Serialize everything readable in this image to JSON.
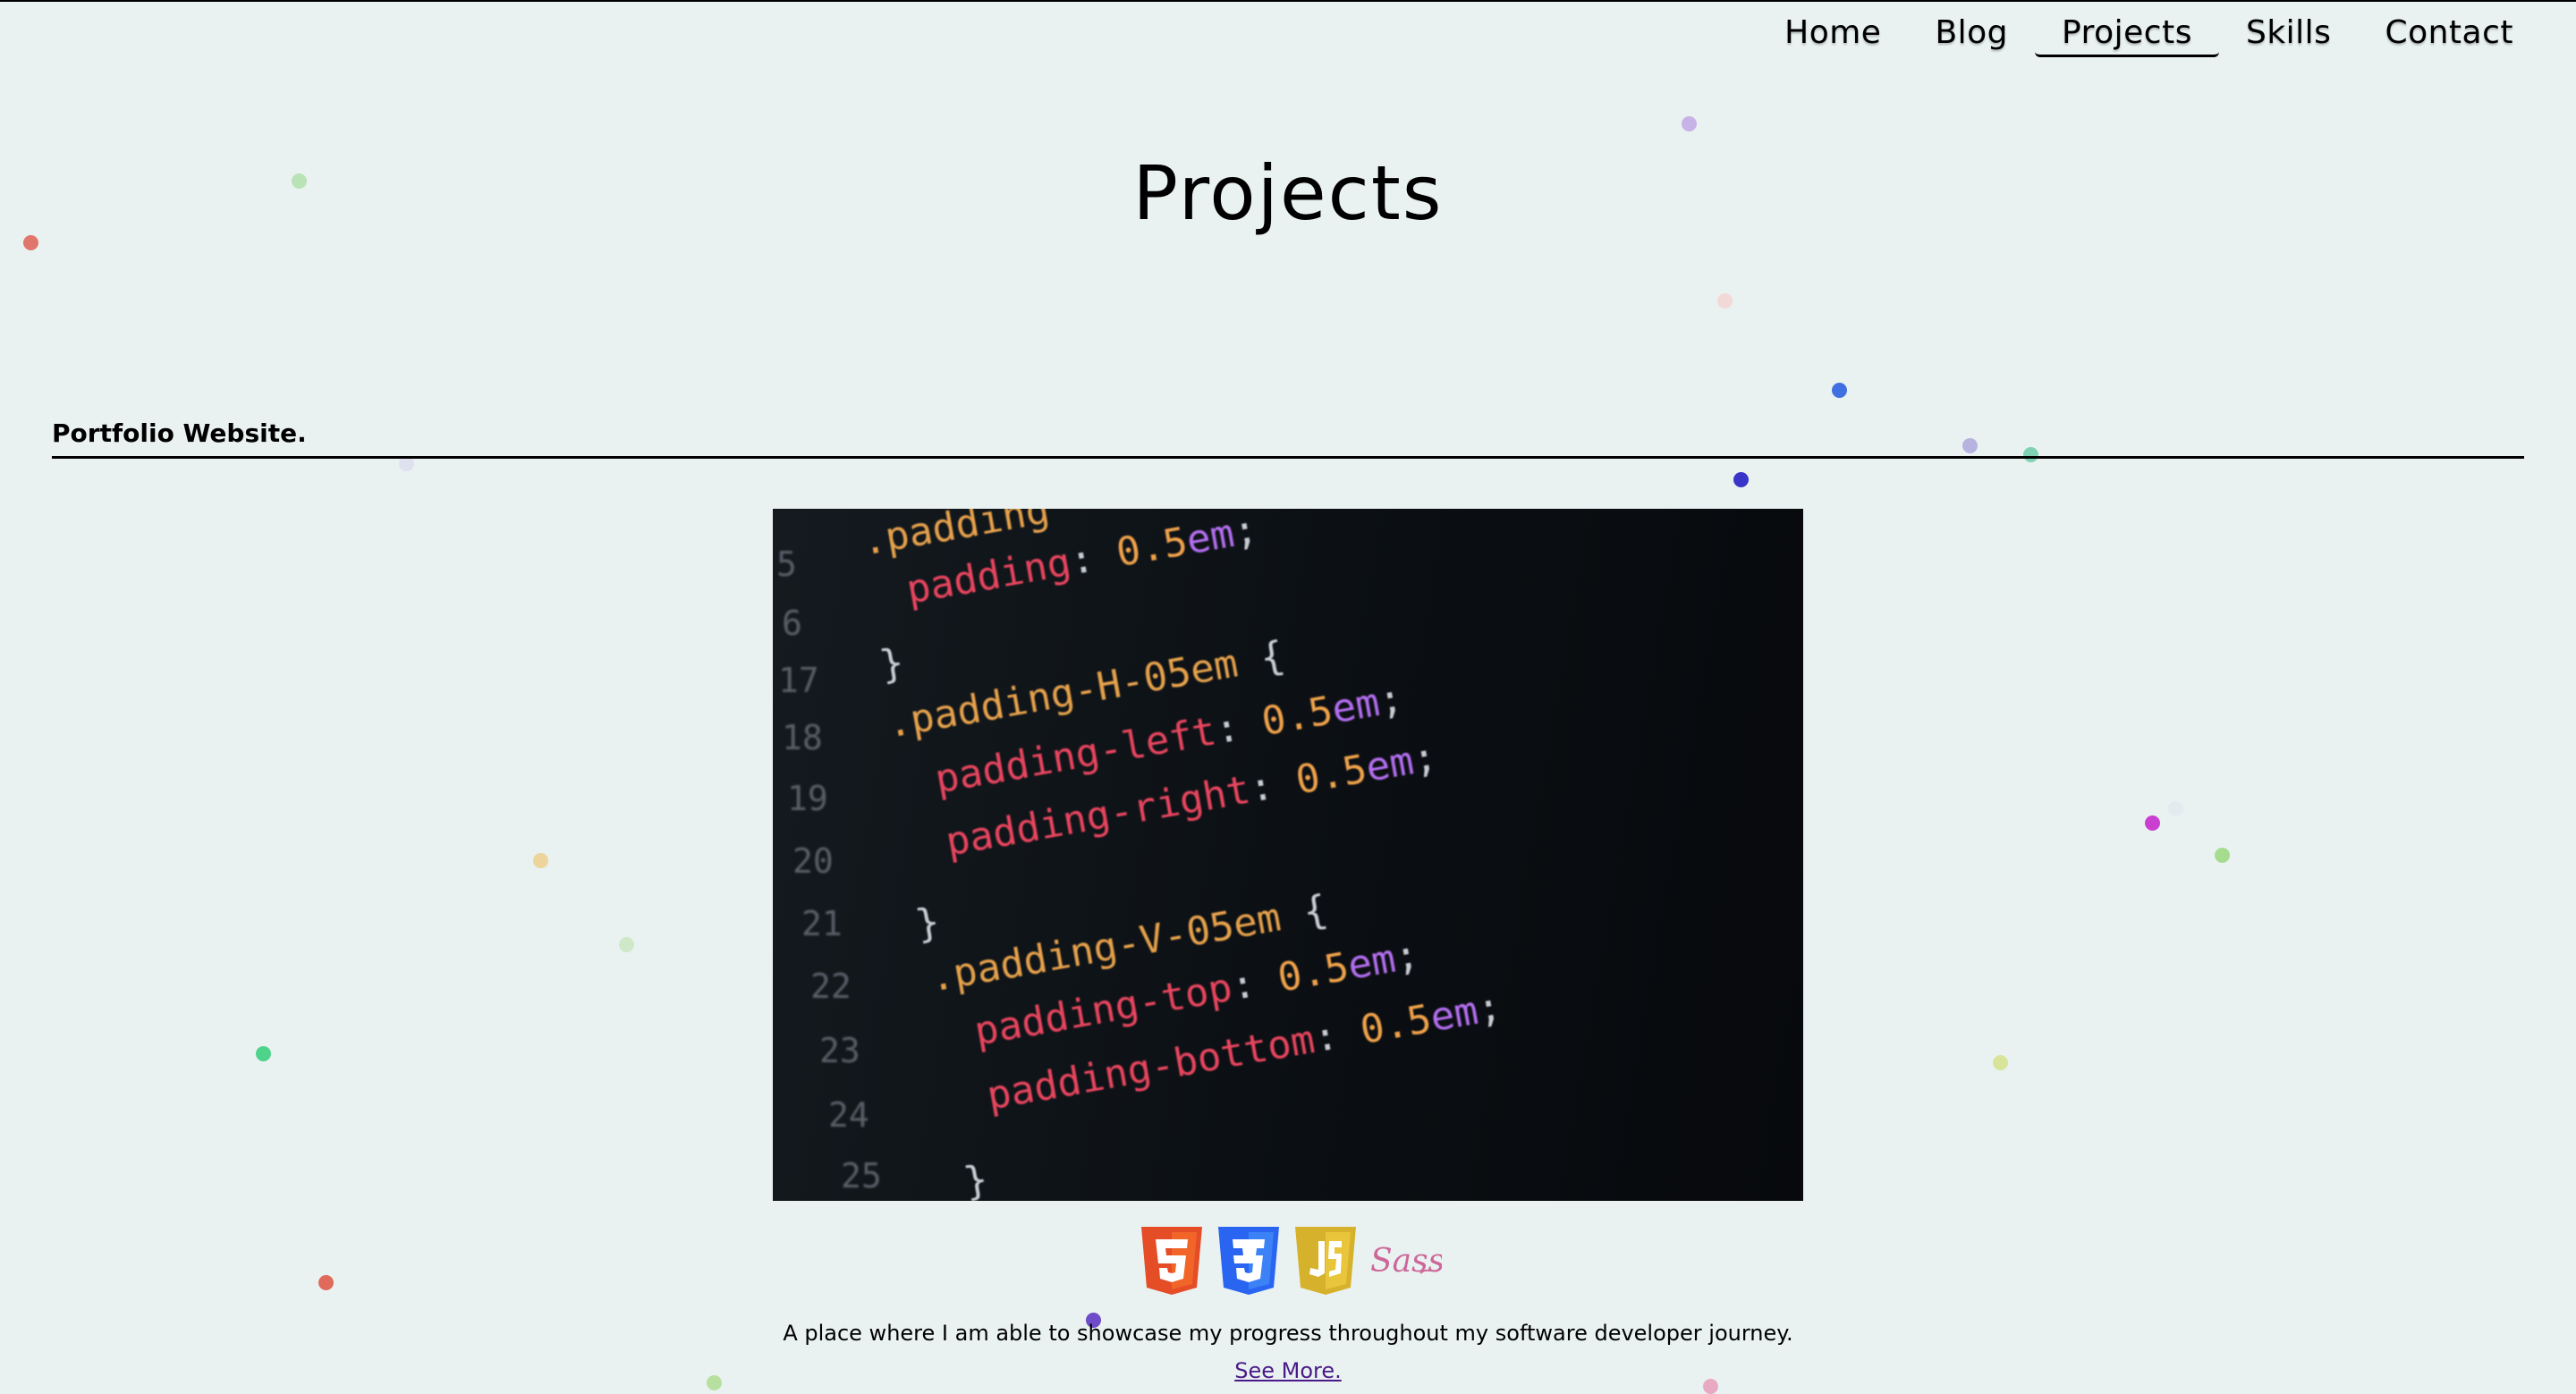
{
  "nav": {
    "items": [
      {
        "label": "Home"
      },
      {
        "label": "Blog"
      },
      {
        "label": "Projects",
        "active": true
      },
      {
        "label": "Skills"
      },
      {
        "label": "Contact"
      }
    ]
  },
  "page": {
    "title": "Projects"
  },
  "project": {
    "title": "Portfolio Website.",
    "image": {
      "icon": "code-screenshot",
      "line_numbers": [
        "5",
        "6",
        "17",
        "18",
        "19",
        "20",
        "21",
        "22",
        "23",
        "24",
        "25"
      ]
    },
    "tech": [
      {
        "icon": "html5-icon",
        "color": "#e44d26"
      },
      {
        "icon": "css3-icon",
        "color": "#2965f1"
      },
      {
        "icon": "javascript-icon",
        "color": "#d6b22c"
      },
      {
        "icon": "sass-icon",
        "color": "#cd6799"
      }
    ],
    "description": "A place where I am able to showcase my progress throughout my software developer journey.",
    "link": "See More."
  },
  "colors": {
    "background": "#e9f2f1",
    "link": "#4b1a8a"
  }
}
